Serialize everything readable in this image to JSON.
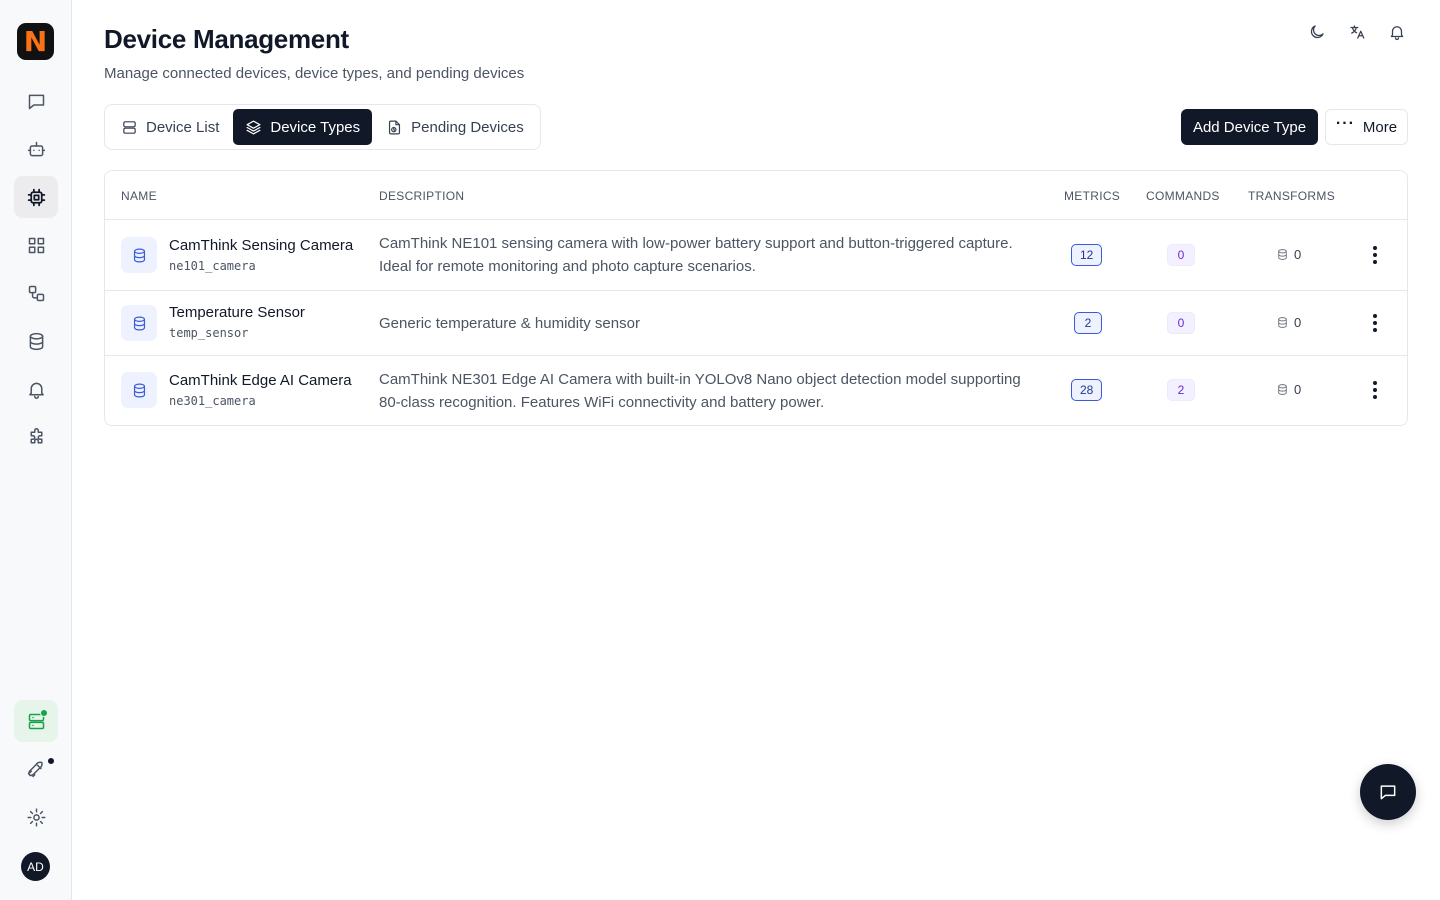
{
  "brand": {
    "logo_letter": "N",
    "accent": "#f97316"
  },
  "sidebar": {
    "items": [
      {
        "name": "chat-icon"
      },
      {
        "name": "bot-icon"
      },
      {
        "name": "chip-icon",
        "active": true
      },
      {
        "name": "grid-icon"
      },
      {
        "name": "workflow-icon"
      },
      {
        "name": "database-icon"
      },
      {
        "name": "bell-icon"
      },
      {
        "name": "puzzle-icon"
      }
    ],
    "bottom": [
      {
        "name": "server-status-icon"
      },
      {
        "name": "rocket-icon"
      },
      {
        "name": "gear-icon"
      }
    ],
    "avatar_initials": "AD"
  },
  "header": {
    "title": "Device Management",
    "subtitle": "Manage connected devices, device types, and pending devices",
    "icons": [
      "moon-icon",
      "translate-icon",
      "bell-icon"
    ]
  },
  "tabs": [
    {
      "label": "Device List",
      "icon": "list-icon",
      "active": false
    },
    {
      "label": "Device Types",
      "icon": "layers-icon",
      "active": true
    },
    {
      "label": "Pending Devices",
      "icon": "file-pending-icon",
      "active": false
    }
  ],
  "actions": {
    "add_label": "Add Device Type",
    "more_label": "More",
    "more_dots": "···"
  },
  "table": {
    "columns": {
      "name": "NAME",
      "description": "DESCRIPTION",
      "metrics": "METRICS",
      "commands": "COMMANDS",
      "transforms": "TRANSFORMS"
    },
    "rows": [
      {
        "name": "CamThink Sensing Camera",
        "code": "ne101_camera",
        "description": "CamThink NE101 sensing camera with low-power battery support and button-triggered capture. Ideal for remote monitoring and photo capture scenarios.",
        "metrics": "12",
        "commands": "0",
        "transforms": "0"
      },
      {
        "name": "Temperature Sensor",
        "code": "temp_sensor",
        "description": "Generic temperature & humidity sensor",
        "metrics": "2",
        "commands": "0",
        "transforms": "0"
      },
      {
        "name": "CamThink Edge AI Camera",
        "code": "ne301_camera",
        "description": "CamThink NE301 Edge AI Camera with built-in YOLOv8 Nano object detection model supporting 80-class recognition. Features WiFi connectivity and battery power.",
        "metrics": "28",
        "commands": "2",
        "transforms": "0"
      }
    ]
  }
}
